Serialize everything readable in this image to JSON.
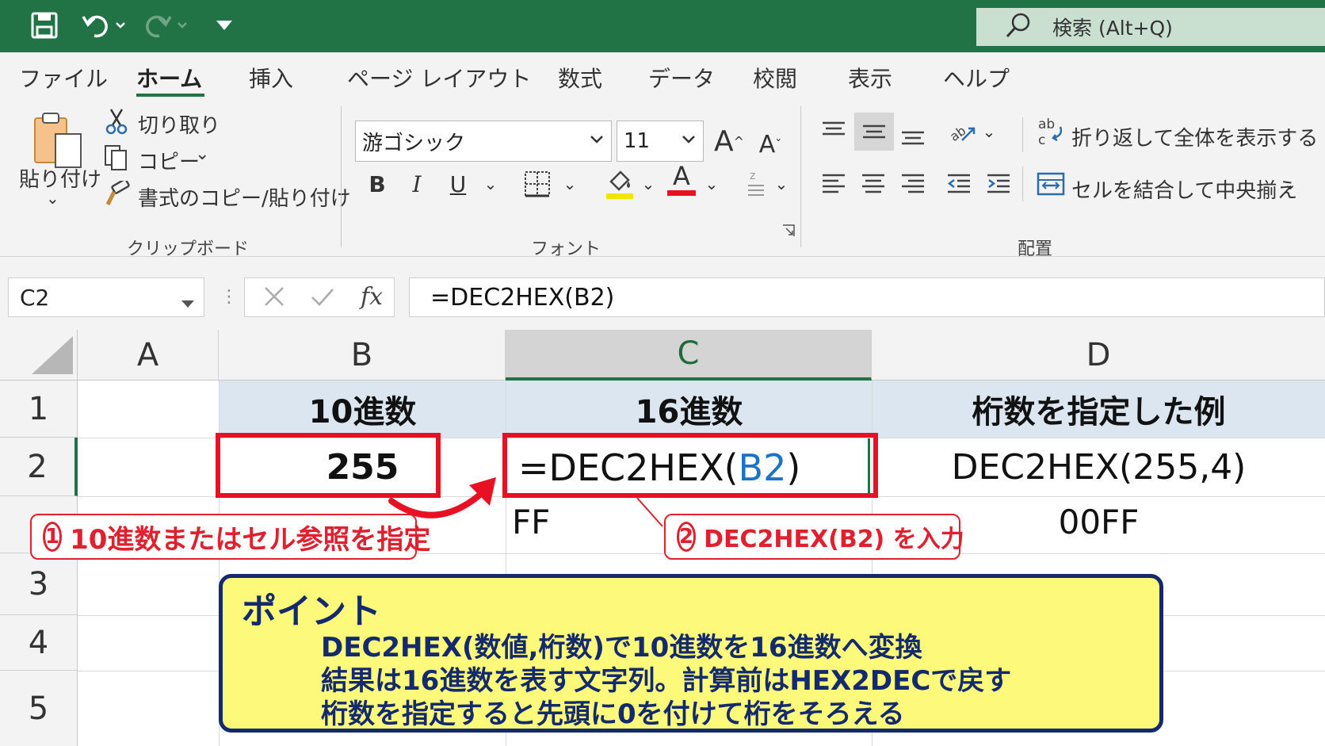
{
  "title_bar": {
    "search_text": "検索 (Alt+Q)"
  },
  "tabs": [
    "ファイル",
    "ホーム",
    "挿入",
    "ページ レイアウト",
    "数式",
    "データ",
    "校閲",
    "表示",
    "ヘルプ"
  ],
  "active_tab": "ホーム",
  "clipboard": {
    "paste_label": "貼り付け",
    "cut_label": "切り取り",
    "copy_label": "コピー",
    "format_painter_label": "書式のコピー/貼り付け",
    "group_label": "クリップボード"
  },
  "font": {
    "font_name": "游ゴシック",
    "font_size": "11",
    "bold": "B",
    "italic": "I",
    "underline": "U",
    "font_color_letter": "A",
    "group_label": "フォント"
  },
  "alignment": {
    "wrap_text_label": "折り返して全体を表示する",
    "merge_center_label": "セルを結合して中央揃え",
    "group_label": "配置"
  },
  "formula_bar": {
    "name_box": "C2",
    "fx": "fx",
    "formula": "=DEC2HEX(B2)"
  },
  "grid": {
    "columns": [
      "A",
      "B",
      "C",
      "D"
    ],
    "selected_column": "C",
    "rows": [
      "1",
      "2",
      "3",
      "4",
      "5"
    ],
    "cells": {
      "B1": "10進数",
      "C1": "16進数",
      "D1": "桁数を指定した例",
      "B2": "255",
      "C2_prefix": "=DEC2HEX(",
      "C2_ref": "B2",
      "C2_suffix": ")",
      "D2": "DEC2HEX(255,4)",
      "C_result": "FF",
      "D_result": "00FF"
    }
  },
  "callouts": {
    "first_num": "1",
    "first_text": "10進数またはセル参照を指定",
    "second_num": "2",
    "second_text": "DEC2HEX(B2) を入力"
  },
  "point_box": {
    "title": "ポイント",
    "lines": [
      "DEC2HEX(数値,桁数)で10進数を16進数へ変換",
      "結果は16進数を表す文字列。計算前はHEX2DECで戻す",
      "桁数を指定すると先頭に0を付けて桁をそろえる"
    ]
  },
  "colors": {
    "excel_green": "#217346",
    "callout_red": "#e0202e",
    "point_fill": "#fdf97a",
    "point_text": "#142a6e",
    "reference_blue": "#1a73c8"
  }
}
